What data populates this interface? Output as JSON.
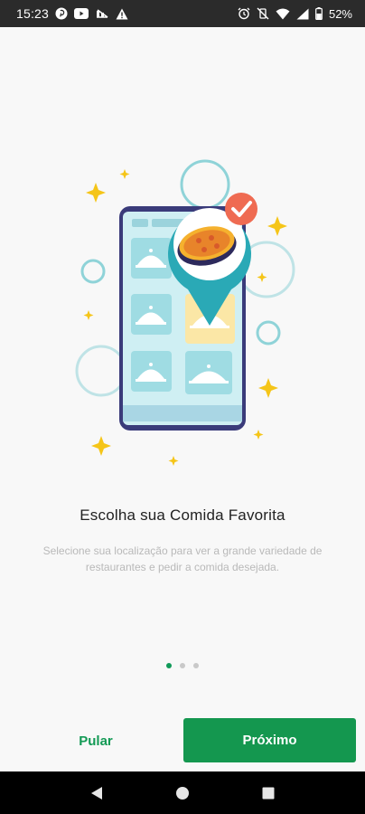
{
  "status_bar": {
    "time": "15:23",
    "battery": "52%",
    "left_icons": [
      "pinterest-icon",
      "youtube-icon",
      "signal-off-icon",
      "warning-icon"
    ],
    "right_icons": [
      "alarm-icon",
      "vibrate-off-icon",
      "wifi-icon",
      "signal-icon",
      "battery-icon"
    ]
  },
  "onboarding": {
    "title": "Escolha sua Comida Favorita",
    "description": "Selecione sua localização para ver a grande variedade de restaurantes e pedir a comida desejada.",
    "page_current": 1,
    "page_total": 3
  },
  "actions": {
    "skip_label": "Pular",
    "next_label": "Próximo"
  },
  "colors": {
    "primary": "#14974f",
    "accent_teal": "#2aa9b6",
    "accent_orange": "#ef6b52",
    "sparkle": "#f5c518"
  },
  "navigation": {
    "icons": [
      "back-icon",
      "home-icon",
      "recents-icon"
    ]
  }
}
